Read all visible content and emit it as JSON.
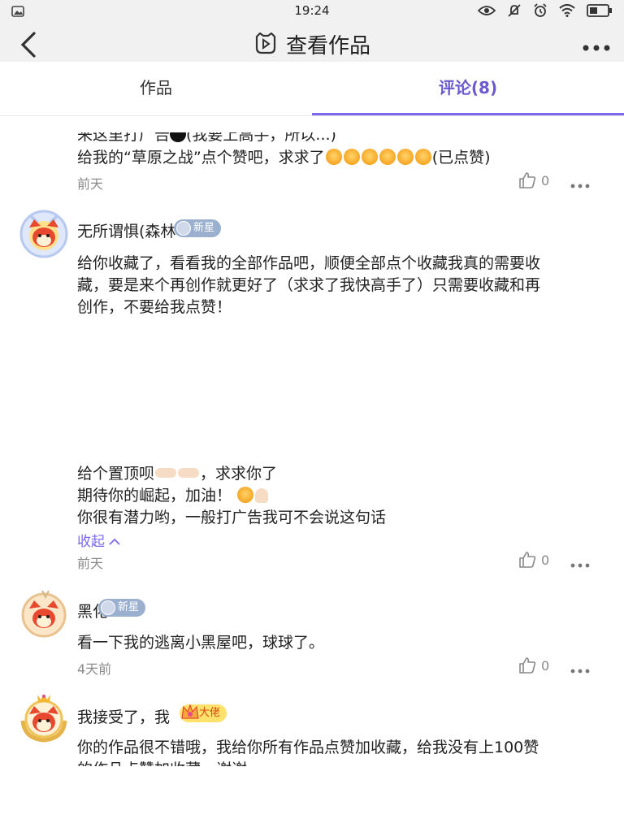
{
  "status_bar": {
    "time": "19:24"
  },
  "nav": {
    "title": "查看作品"
  },
  "tabs": {
    "works": "作品",
    "comments": "评论(8)"
  },
  "comments": [
    {
      "partial_line": "来这里打广告",
      "partial_line_tail": "(我要上高手，所以...)",
      "line": "给我的“草原之战”点个赞吧，求求了",
      "line_tail": "(已点赞)",
      "time": "前天",
      "likes": "0"
    },
    {
      "username": "无所谓惧(森林",
      "badge": "新星",
      "body_lines": [
        "给你收藏了，看看我的全部作品吧，顺便全部点个收藏我真的需要收",
        "藏，要是来个再创作就更好了（求求了我快高手了）只需要收藏和再",
        "创作，不要给我点赞！"
      ],
      "extra_line1": "给个置顶呗",
      "extra_line1_tail": "，求求你了",
      "extra_line2": "期待你的崛起，加油！",
      "extra_line3": "你很有潜力哟，一般打广告我可不会说这句话",
      "collapse": "收起",
      "time": "前天",
      "likes": "0"
    },
    {
      "username": "黑化",
      "badge": "新星",
      "body": "看一下我的逃离小黑屋吧，球球了。",
      "time": "4天前",
      "likes": "0"
    },
    {
      "username": "我接受了，我",
      "badge": "大佬",
      "body_lines": [
        "你的作品很不错哦，我给你所有作品点赞加收藏，给我没有上100赞",
        "的作品点赞加收藏，谢谢"
      ]
    }
  ],
  "colors": {
    "accent": "#7b68ee",
    "badge_blue": "#9bb0cf",
    "badge_gold": "#ffe16b"
  }
}
